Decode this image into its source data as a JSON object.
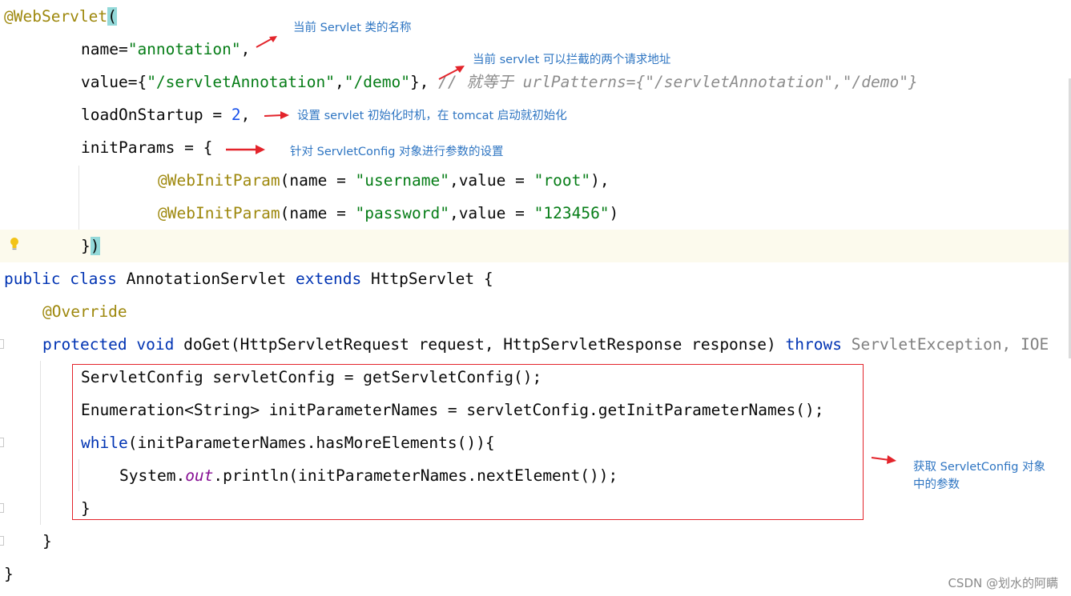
{
  "code": {
    "l1": {
      "ann": "@WebServlet",
      "paren": "("
    },
    "l2": {
      "key": "name=",
      "str": "\"annotation\"",
      "tail": ","
    },
    "l3": {
      "key": "value={",
      "s1": "\"/servletAnnotation\"",
      "comma": ",",
      "s2": "\"/demo\"",
      "tail": "},",
      "comment": "// 就等于 urlPatterns={\"/servletAnnotation\",\"/demo\"}"
    },
    "l4": {
      "key": "loadOnStartup = ",
      "num": "2",
      "tail": ","
    },
    "l5": {
      "key": "initParams = {"
    },
    "l6": {
      "ann": "@WebInitParam",
      "a": "(name = ",
      "s1": "\"username\"",
      "b": ",value = ",
      "s2": "\"root\"",
      "c": "),"
    },
    "l7": {
      "ann": "@WebInitParam",
      "a": "(name = ",
      "s1": "\"password\"",
      "b": ",value = ",
      "s2": "\"123456\"",
      "c": ")"
    },
    "l8": {
      "brace": "}",
      "paren": ")"
    },
    "l9": {
      "k1": "public",
      "k2": "class",
      "name": "AnnotationServlet",
      "k3": "extends",
      "sup": "HttpServlet {"
    },
    "l10": {
      "ann": "@Override"
    },
    "l11": {
      "k1": "protected",
      "k2": "void",
      "sig": "doGet(HttpServletRequest request, HttpServletResponse response)",
      "k3": "throws",
      "exc": "ServletException, IOE"
    },
    "l12": {
      "text": "ServletConfig servletConfig = getServletConfig();"
    },
    "l13": {
      "text": "Enumeration<String> initParameterNames = servletConfig.getInitParameterNames();"
    },
    "l14": {
      "kw": "while",
      "text": "(initParameterNames.hasMoreElements()){"
    },
    "l15": {
      "a": "System.",
      "out": "out",
      "b": ".println(initParameterNames.nextElement());"
    },
    "l16": {
      "text": "}"
    },
    "l17": {
      "text": "}"
    },
    "l18": {
      "text": "}"
    }
  },
  "notes": {
    "n1": "当前 Servlet 类的名称",
    "n2": "当前 servlet 可以拦截的两个请求地址",
    "n3": "设置 servlet 初始化时机，在 tomcat 启动就初始化",
    "n4": "针对 ServletConfig 对象进行参数的设置",
    "n5a": "获取 ServletConfig 对象",
    "n5b": "中的参数"
  },
  "icons": {
    "bulb": "lightbulb-icon"
  },
  "colors": {
    "annotation": "#9e880d",
    "string": "#067d17",
    "keyword": "#0033b3",
    "number": "#1750eb",
    "note": "#2e75c2",
    "arrow": "#e3242b"
  },
  "watermark": "CSDN @划水的阿瞒"
}
